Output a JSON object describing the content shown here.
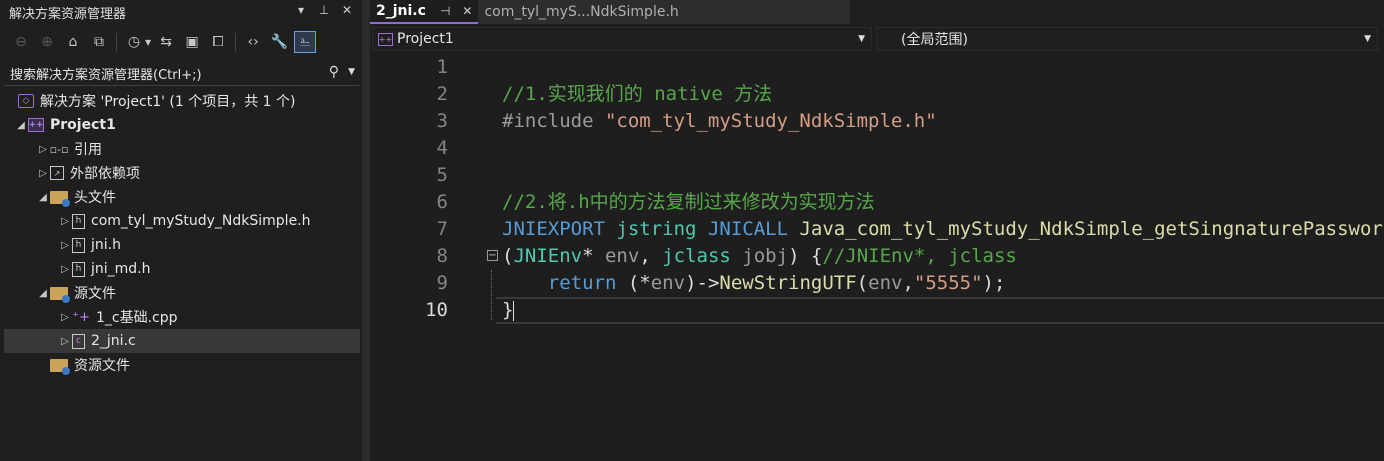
{
  "solution_explorer": {
    "title": "解决方案资源管理器",
    "title_buttons": [
      "▾",
      "⊥",
      "✕"
    ],
    "search_placeholder": "搜索解决方案资源管理器(Ctrl+;)",
    "tree": [
      {
        "label": "解决方案 'Project1' (1 个项目，共 1 个)",
        "icon": "solution-icon",
        "glyph": "◇",
        "indent": 0,
        "arrow": "",
        "bold": false
      },
      {
        "label": "Project1",
        "icon": "project-icon",
        "glyph": "++",
        "indent": 0,
        "arrow": "◢",
        "bold": true
      },
      {
        "label": "引用",
        "icon": "references-icon",
        "glyph": "▫-▫",
        "indent": 1,
        "arrow": "▷",
        "bold": false
      },
      {
        "label": "外部依赖项",
        "icon": "external-dependencies-icon",
        "glyph": "↗",
        "indent": 1,
        "arrow": "▷",
        "bold": false
      },
      {
        "label": "头文件",
        "icon": "folder-icon",
        "glyph": "",
        "indent": 1,
        "arrow": "◢",
        "bold": false
      },
      {
        "label": "com_tyl_myStudy_NdkSimple.h",
        "icon": "header-file-icon",
        "glyph": "h",
        "indent": 2,
        "arrow": "▷",
        "bold": false
      },
      {
        "label": "jni.h",
        "icon": "header-file-icon",
        "glyph": "h",
        "indent": 2,
        "arrow": "▷",
        "bold": false
      },
      {
        "label": "jni_md.h",
        "icon": "header-file-icon",
        "glyph": "h",
        "indent": 2,
        "arrow": "▷",
        "bold": false
      },
      {
        "label": "源文件",
        "icon": "folder-icon",
        "glyph": "",
        "indent": 1,
        "arrow": "◢",
        "bold": false
      },
      {
        "label": "1_c基础.cpp",
        "icon": "cpp-file-icon",
        "glyph": "⁺+",
        "indent": 2,
        "arrow": "▷",
        "bold": false
      },
      {
        "label": "2_jni.c",
        "icon": "c-file-icon",
        "glyph": "c",
        "indent": 2,
        "arrow": "▷",
        "bold": false,
        "selected": true
      },
      {
        "label": "资源文件",
        "icon": "folder-icon",
        "glyph": "",
        "indent": 1,
        "arrow": "",
        "bold": false
      }
    ]
  },
  "editor": {
    "tabs": [
      {
        "label": "2_jni.c",
        "active": true,
        "pin": "⊣",
        "close": "✕"
      },
      {
        "label": "com_tyl_myS...NdkSimple.h",
        "active": false
      }
    ],
    "nav_project": "Project1",
    "nav_scope": "(全局范围)",
    "current_line": 10,
    "lines": [
      {
        "n": "1",
        "parts": []
      },
      {
        "n": "2",
        "parts": [
          {
            "t": "//1.实现我们的 native 方法",
            "c": "comment"
          }
        ]
      },
      {
        "n": "3",
        "parts": [
          {
            "t": "#include ",
            "c": "pre"
          },
          {
            "t": "\"com_tyl_myStudy_NdkSimple.h\"",
            "c": "str"
          }
        ]
      },
      {
        "n": "4",
        "parts": []
      },
      {
        "n": "5",
        "parts": []
      },
      {
        "n": "6",
        "parts": [
          {
            "t": "//2.将.h中的方法复制过来修改为实现方法",
            "c": "comment"
          }
        ]
      },
      {
        "n": "7",
        "parts": [
          {
            "t": "JNIEXPORT",
            "c": "kw"
          },
          {
            "t": " ",
            "c": "plain"
          },
          {
            "t": "jstring",
            "c": "type"
          },
          {
            "t": " ",
            "c": "plain"
          },
          {
            "t": "JNICALL",
            "c": "kw"
          },
          {
            "t": " ",
            "c": "plain"
          },
          {
            "t": "Java_com_tyl_myStudy_NdkSimple_getSingnaturePassword",
            "c": "func"
          }
        ]
      },
      {
        "n": "8",
        "parts": [
          {
            "t": "(",
            "c": "plain"
          },
          {
            "t": "JNIEnv",
            "c": "type"
          },
          {
            "t": "* ",
            "c": "plain"
          },
          {
            "t": "env",
            "c": "param"
          },
          {
            "t": ", ",
            "c": "plain"
          },
          {
            "t": "jclass",
            "c": "type"
          },
          {
            "t": " ",
            "c": "plain"
          },
          {
            "t": "jobj",
            "c": "param"
          },
          {
            "t": ") {",
            "c": "plain"
          },
          {
            "t": "//JNIEnv*, jclass",
            "c": "comment"
          }
        ]
      },
      {
        "n": "9",
        "parts": [
          {
            "t": "    ",
            "c": "plain"
          },
          {
            "t": "return",
            "c": "kw"
          },
          {
            "t": " (*",
            "c": "plain"
          },
          {
            "t": "env",
            "c": "param"
          },
          {
            "t": ")->",
            "c": "plain"
          },
          {
            "t": "NewStringUTF",
            "c": "func"
          },
          {
            "t": "(",
            "c": "plain"
          },
          {
            "t": "env",
            "c": "param"
          },
          {
            "t": ",",
            "c": "plain"
          },
          {
            "t": "\"5555\"",
            "c": "str"
          },
          {
            "t": ");",
            "c": "plain"
          }
        ]
      },
      {
        "n": "10",
        "parts": [
          {
            "t": "}",
            "c": "plain"
          }
        ]
      }
    ]
  }
}
